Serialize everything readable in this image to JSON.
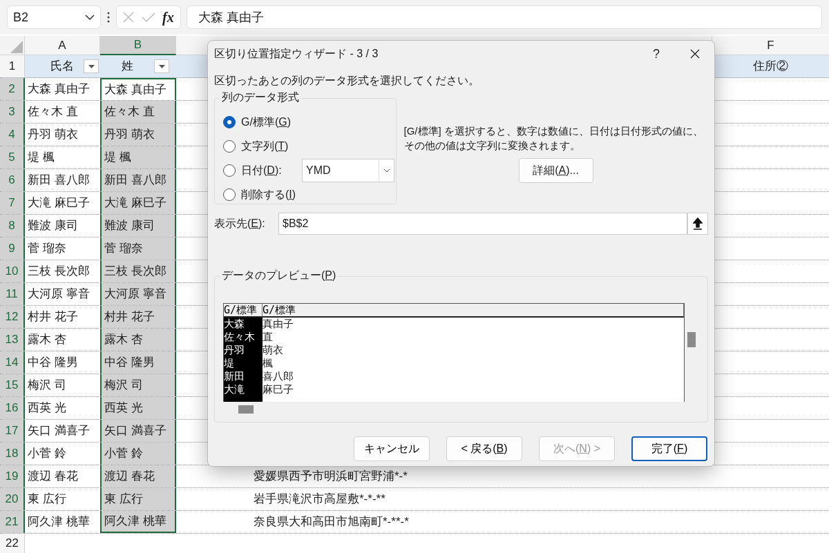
{
  "formula_bar": {
    "name_box": "B2",
    "fx_label": "fx",
    "formula": "大森 真由子"
  },
  "columns": [
    {
      "letter": "A",
      "selected": false
    },
    {
      "letter": "B",
      "selected": true
    },
    {
      "letter": "F",
      "selected": false
    }
  ],
  "header_row": {
    "number": "1",
    "cells": [
      "氏名",
      "姓",
      "住所②"
    ]
  },
  "rows": [
    {
      "number": "2",
      "selected": true,
      "name": "大森 真由子",
      "sei": "大森 真由子"
    },
    {
      "number": "3",
      "selected": true,
      "name": "佐々木 直",
      "sei": "佐々木 直"
    },
    {
      "number": "4",
      "selected": true,
      "name": "丹羽 萌衣",
      "sei": "丹羽 萌衣"
    },
    {
      "number": "5",
      "selected": true,
      "name": "堤 楓",
      "sei": "堤 楓"
    },
    {
      "number": "6",
      "selected": true,
      "name": "新田 喜八郎",
      "sei": "新田 喜八郎"
    },
    {
      "number": "7",
      "selected": true,
      "name": "大滝 麻巳子",
      "sei": "大滝 麻巳子"
    },
    {
      "number": "8",
      "selected": true,
      "name": "難波 康司",
      "sei": "難波 康司"
    },
    {
      "number": "9",
      "selected": true,
      "name": "菅 瑠奈",
      "sei": "菅 瑠奈"
    },
    {
      "number": "10",
      "selected": true,
      "name": "三枝 長次郎",
      "sei": "三枝 長次郎"
    },
    {
      "number": "11",
      "selected": true,
      "name": "大河原 寧音",
      "sei": "大河原 寧音"
    },
    {
      "number": "12",
      "selected": true,
      "name": "村井 花子",
      "sei": "村井 花子"
    },
    {
      "number": "13",
      "selected": true,
      "name": "露木 杏",
      "sei": "露木 杏"
    },
    {
      "number": "14",
      "selected": true,
      "name": "中谷 隆男",
      "sei": "中谷 隆男"
    },
    {
      "number": "15",
      "selected": true,
      "name": "梅沢 司",
      "sei": "梅沢 司"
    },
    {
      "number": "16",
      "selected": true,
      "name": "西英 光",
      "sei": "西英 光"
    },
    {
      "number": "17",
      "selected": true,
      "name": "矢口 満喜子",
      "sei": "矢口 満喜子"
    },
    {
      "number": "18",
      "selected": true,
      "name": "小菅 鈴",
      "sei": "小菅 鈴"
    },
    {
      "number": "19",
      "selected": true,
      "name": "渡辺 春花",
      "sei": "渡辺 春花",
      "address": "愛媛県西予市明浜町宮野浦*-*"
    },
    {
      "number": "20",
      "selected": true,
      "name": "東 広行",
      "sei": "東 広行",
      "address": "岩手県滝沢市高屋敷*-*-**"
    },
    {
      "number": "21",
      "selected": true,
      "name": "阿久津 桃華",
      "sei": "阿久津 桃華",
      "address": "奈良県大和高田市旭南町*-**-*"
    },
    {
      "number": "22",
      "selected": false
    }
  ],
  "dialog": {
    "title": "区切り位置指定ウィザード - 3 / 3",
    "help": "?",
    "instruction": "区切ったあとの列のデータ形式を選択してください。",
    "format_group": {
      "title": "列のデータ形式",
      "options": [
        {
          "label": "G/標準(G)",
          "selected": true
        },
        {
          "label": "文字列(T)",
          "selected": false
        },
        {
          "label": "日付(D):",
          "selected": false,
          "dropdown": "YMD"
        },
        {
          "label": "削除する(I)",
          "selected": false
        }
      ]
    },
    "description": "[G/標準] を選択すると、数字は数値に、日付は日付形式の値に、その他の値は文字列に変換されます。",
    "advanced_button": "詳細(A)...",
    "destination": {
      "label": "表示先(E):",
      "value": "$B$2"
    },
    "preview": {
      "title": "データのプレビュー(P)",
      "columns": [
        {
          "header": "G/標準",
          "selected": true,
          "values": [
            "大森",
            "佐々木",
            "丹羽",
            "堤",
            "新田",
            "大滝"
          ]
        },
        {
          "header": "G/標準",
          "selected": false,
          "values": [
            "真由子",
            "直",
            "萌衣",
            "楓",
            "喜八郎",
            "麻巳子"
          ]
        }
      ]
    },
    "buttons": [
      {
        "label": "キャンセル",
        "disabled": false,
        "default": false
      },
      {
        "label": "< 戻る(B)",
        "disabled": false,
        "default": false
      },
      {
        "label": "次へ(N) >",
        "disabled": true,
        "default": false
      },
      {
        "label": "完了(F)",
        "disabled": false,
        "default": true
      }
    ]
  }
}
